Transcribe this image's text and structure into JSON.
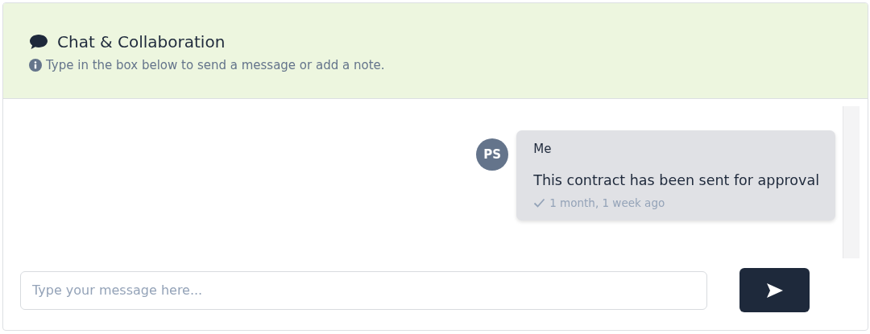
{
  "header": {
    "title": "Chat & Collaboration",
    "hint": "Type in the box below to send a message or add a note."
  },
  "messages": [
    {
      "initials": "PS",
      "author": "Me",
      "text": "This contract has been sent for approval",
      "time": "1 month, 1 week ago",
      "delivered": true,
      "mine": true
    }
  ],
  "composer": {
    "placeholder": "Type your message here..."
  }
}
